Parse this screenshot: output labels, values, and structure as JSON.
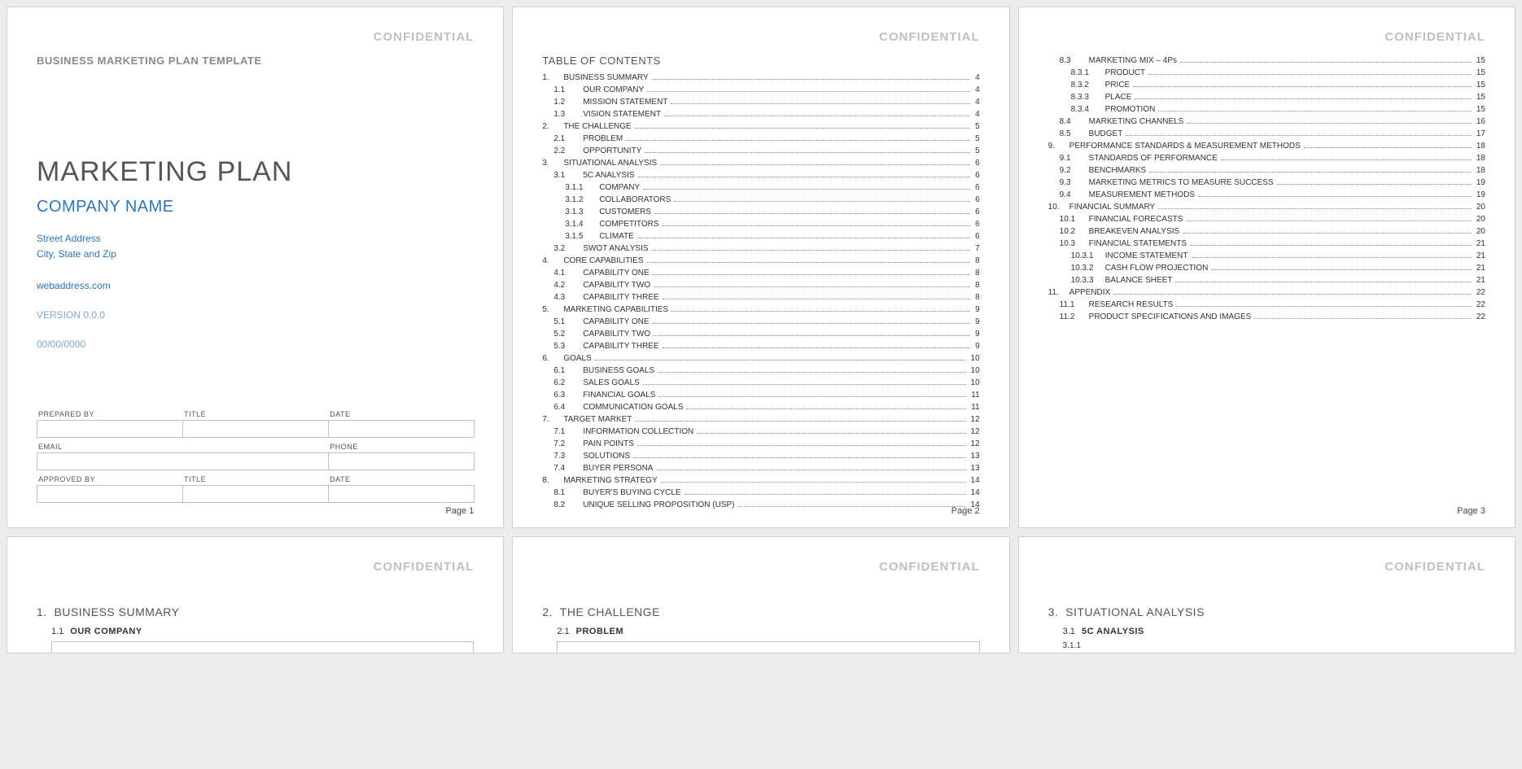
{
  "confidential": "CONFIDENTIAL",
  "page1": {
    "subtitle": "BUSINESS MARKETING PLAN TEMPLATE",
    "title": "MARKETING PLAN",
    "company": "COMPANY NAME",
    "addr1": "Street Address",
    "addr2": "City, State and Zip",
    "web": "webaddress.com",
    "version": "VERSION 0.0.0",
    "date": "00/00/0000",
    "form": {
      "prepared_by": "PREPARED BY",
      "title": "TITLE",
      "date": "DATE",
      "email": "EMAIL",
      "phone": "PHONE",
      "approved_by": "APPROVED BY"
    },
    "footer": "Page 1"
  },
  "page2": {
    "toc_title": "TABLE OF CONTENTS",
    "entries": [
      {
        "l": 1,
        "n": "1.",
        "t": "BUSINESS SUMMARY",
        "p": "4"
      },
      {
        "l": 2,
        "n": "1.1",
        "t": "OUR COMPANY",
        "p": "4"
      },
      {
        "l": 2,
        "n": "1.2",
        "t": "MISSION STATEMENT",
        "p": "4"
      },
      {
        "l": 2,
        "n": "1.3",
        "t": "VISION STATEMENT",
        "p": "4"
      },
      {
        "l": 1,
        "n": "2.",
        "t": "THE CHALLENGE",
        "p": "5"
      },
      {
        "l": 2,
        "n": "2.1",
        "t": "PROBLEM",
        "p": "5"
      },
      {
        "l": 2,
        "n": "2.2",
        "t": "OPPORTUNITY",
        "p": "5"
      },
      {
        "l": 1,
        "n": "3.",
        "t": "SITUATIONAL ANALYSIS",
        "p": "6"
      },
      {
        "l": 2,
        "n": "3.1",
        "t": "5C ANALYSIS",
        "p": "6"
      },
      {
        "l": 3,
        "n": "3.1.1",
        "t": "COMPANY",
        "p": "6"
      },
      {
        "l": 3,
        "n": "3.1.2",
        "t": "COLLABORATORS",
        "p": "6"
      },
      {
        "l": 3,
        "n": "3.1.3",
        "t": "CUSTOMERS",
        "p": "6"
      },
      {
        "l": 3,
        "n": "3.1.4",
        "t": "COMPETITORS",
        "p": "6"
      },
      {
        "l": 3,
        "n": "3.1.5",
        "t": "CLIMATE",
        "p": "6"
      },
      {
        "l": 2,
        "n": "3.2",
        "t": "SWOT ANALYSIS",
        "p": "7"
      },
      {
        "l": 1,
        "n": "4.",
        "t": "CORE CAPABILITIES",
        "p": "8"
      },
      {
        "l": 2,
        "n": "4.1",
        "t": "CAPABILITY ONE",
        "p": "8"
      },
      {
        "l": 2,
        "n": "4.2",
        "t": "CAPABILITY TWO",
        "p": "8"
      },
      {
        "l": 2,
        "n": "4.3",
        "t": "CAPABILITY THREE",
        "p": "8"
      },
      {
        "l": 1,
        "n": "5.",
        "t": "MARKETING CAPABILITIES",
        "p": "9"
      },
      {
        "l": 2,
        "n": "5.1",
        "t": "CAPABILITY ONE",
        "p": "9"
      },
      {
        "l": 2,
        "n": "5.2",
        "t": "CAPABILITY TWO",
        "p": "9"
      },
      {
        "l": 2,
        "n": "5.3",
        "t": "CAPABILITY THREE",
        "p": "9"
      },
      {
        "l": 1,
        "n": "6.",
        "t": "GOALS",
        "p": "10"
      },
      {
        "l": 2,
        "n": "6.1",
        "t": "BUSINESS GOALS",
        "p": "10"
      },
      {
        "l": 2,
        "n": "6.2",
        "t": "SALES GOALS",
        "p": "10"
      },
      {
        "l": 2,
        "n": "6.3",
        "t": "FINANCIAL GOALS",
        "p": "11"
      },
      {
        "l": 2,
        "n": "6.4",
        "t": "COMMUNICATION GOALS",
        "p": "11"
      },
      {
        "l": 1,
        "n": "7.",
        "t": "TARGET MARKET",
        "p": "12"
      },
      {
        "l": 2,
        "n": "7.1",
        "t": "INFORMATION COLLECTION",
        "p": "12"
      },
      {
        "l": 2,
        "n": "7.2",
        "t": "PAIN POINTS",
        "p": "12"
      },
      {
        "l": 2,
        "n": "7.3",
        "t": "SOLUTIONS",
        "p": "13"
      },
      {
        "l": 2,
        "n": "7.4",
        "t": "BUYER PERSONA",
        "p": "13"
      },
      {
        "l": 1,
        "n": "8.",
        "t": "MARKETING STRATEGY",
        "p": "14"
      },
      {
        "l": 2,
        "n": "8.1",
        "t": "BUYER'S BUYING CYCLE",
        "p": "14"
      },
      {
        "l": 2,
        "n": "8.2",
        "t": "UNIQUE SELLING PROPOSITION (USP)",
        "p": "14"
      }
    ],
    "footer": "Page 2"
  },
  "page3": {
    "entries": [
      {
        "l": 2,
        "n": "8.3",
        "t": "MARKETING MIX – 4Ps",
        "p": "15"
      },
      {
        "l": 3,
        "n": "8.3.1",
        "t": "PRODUCT",
        "p": "15"
      },
      {
        "l": 3,
        "n": "8.3.2",
        "t": "PRICE",
        "p": "15"
      },
      {
        "l": 3,
        "n": "8.3.3",
        "t": "PLACE",
        "p": "15"
      },
      {
        "l": 3,
        "n": "8.3.4",
        "t": "PROMOTION",
        "p": "15"
      },
      {
        "l": 2,
        "n": "8.4",
        "t": "MARKETING CHANNELS",
        "p": "16"
      },
      {
        "l": 2,
        "n": "8.5",
        "t": "BUDGET",
        "p": "17"
      },
      {
        "l": 1,
        "n": "9.",
        "t": "PERFORMANCE STANDARDS & MEASUREMENT METHODS",
        "p": "18"
      },
      {
        "l": 2,
        "n": "9.1",
        "t": "STANDARDS OF PERFORMANCE",
        "p": "18"
      },
      {
        "l": 2,
        "n": "9.2",
        "t": "BENCHMARKS",
        "p": "18"
      },
      {
        "l": 2,
        "n": "9.3",
        "t": "MARKETING METRICS TO MEASURE SUCCESS",
        "p": "19"
      },
      {
        "l": 2,
        "n": "9.4",
        "t": "MEASUREMENT METHODS",
        "p": "19"
      },
      {
        "l": 1,
        "n": "10.",
        "t": "FINANCIAL SUMMARY",
        "p": "20"
      },
      {
        "l": 2,
        "n": "10.1",
        "t": "FINANCIAL FORECASTS",
        "p": "20"
      },
      {
        "l": 2,
        "n": "10.2",
        "t": "BREAKEVEN ANALYSIS",
        "p": "20"
      },
      {
        "l": 2,
        "n": "10.3",
        "t": "FINANCIAL STATEMENTS",
        "p": "21"
      },
      {
        "l": 3,
        "n": "10.3.1",
        "t": "INCOME STATEMENT",
        "p": "21"
      },
      {
        "l": 3,
        "n": "10.3.2",
        "t": "CASH FLOW PROJECTION",
        "p": "21"
      },
      {
        "l": 3,
        "n": "10.3.3",
        "t": "BALANCE SHEET",
        "p": "21"
      },
      {
        "l": 1,
        "n": "11.",
        "t": "APPENDIX",
        "p": "22"
      },
      {
        "l": 2,
        "n": "11.1",
        "t": "RESEARCH RESULTS",
        "p": "22"
      },
      {
        "l": 2,
        "n": "11.2",
        "t": "PRODUCT SPECIFICATIONS AND IMAGES",
        "p": "22"
      }
    ],
    "footer": "Page 3"
  },
  "page4": {
    "h1n": "1.",
    "h1t": "BUSINESS SUMMARY",
    "h2n": "1.1",
    "h2t": "OUR COMPANY"
  },
  "page5": {
    "h1n": "2.",
    "h1t": "THE CHALLENGE",
    "h2n": "2.1",
    "h2t": "PROBLEM"
  },
  "page6": {
    "h1n": "3.",
    "h1t": "SITUATIONAL ANALYSIS",
    "h2n": "3.1",
    "h2t": "5C ANALYSIS",
    "h3n": "3.1.1"
  }
}
